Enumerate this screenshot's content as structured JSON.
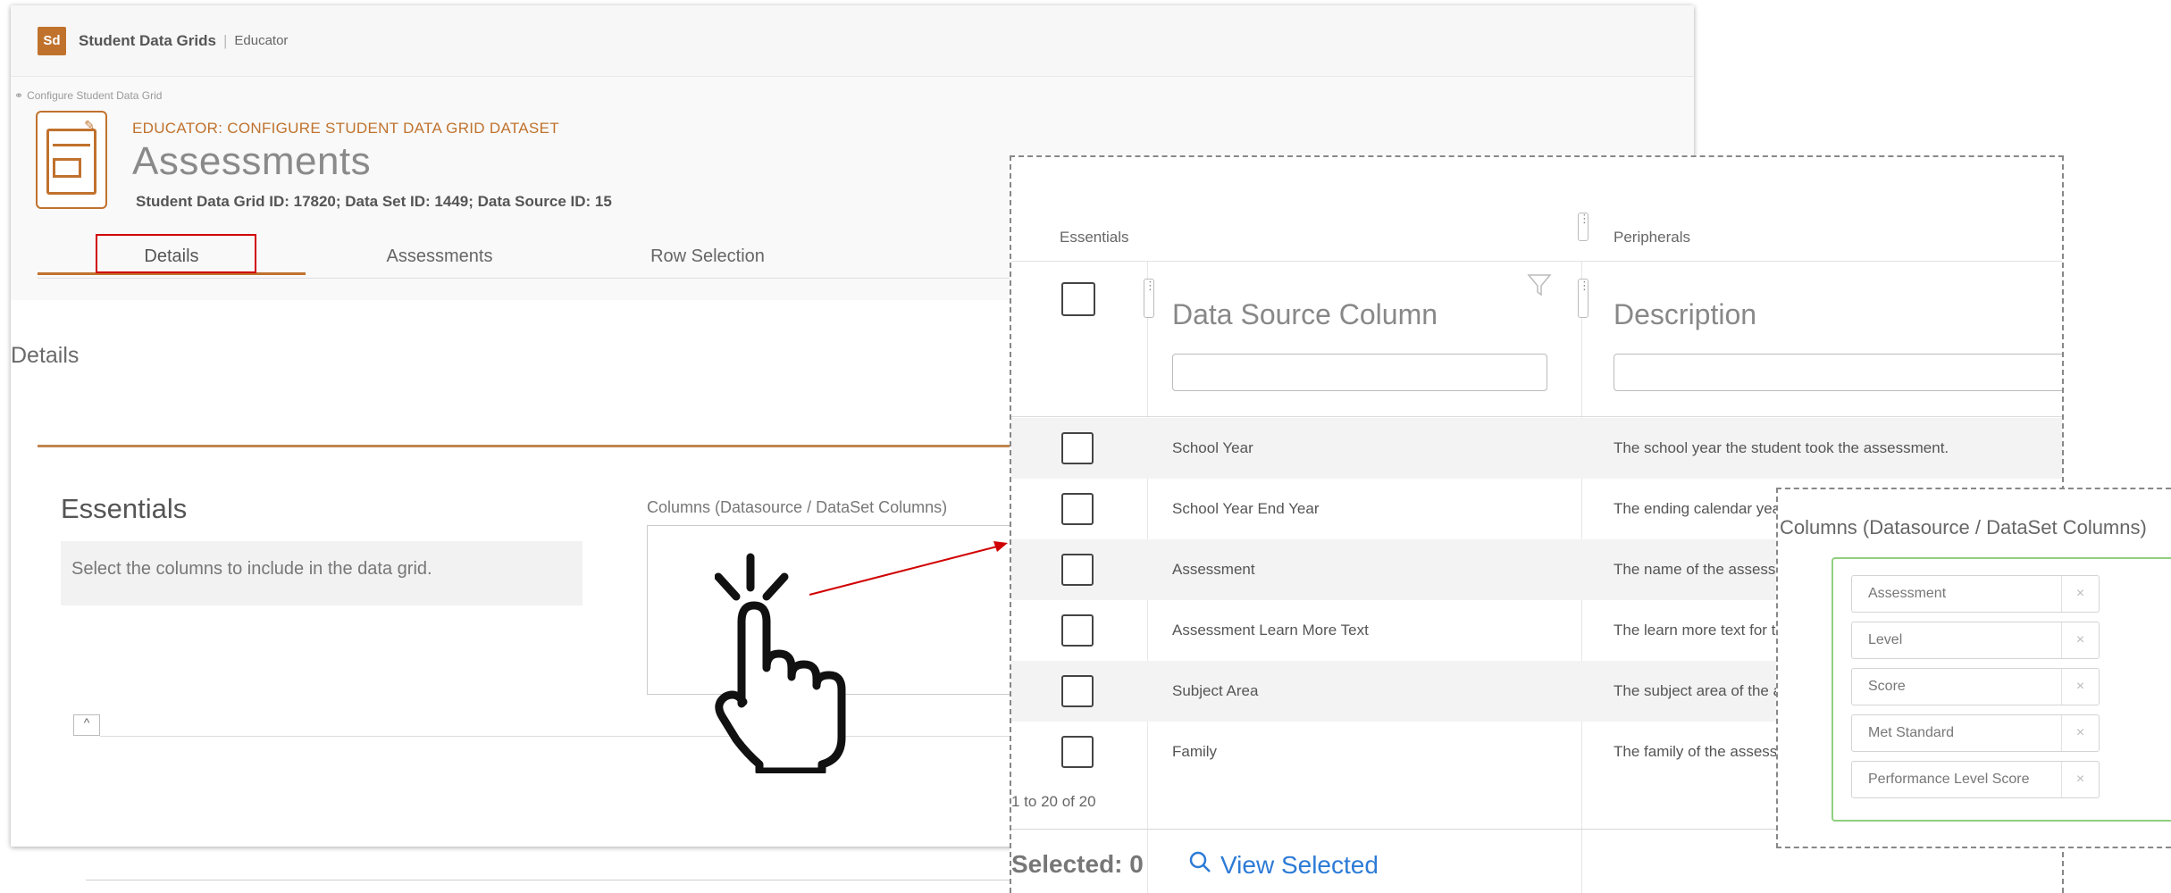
{
  "app": {
    "logo": "Sd",
    "title": "Student Data Grids",
    "separator": "|",
    "role": "Educator"
  },
  "breadcrumb": "Configure Student Data Grid",
  "header": {
    "eyebrow": "EDUCATOR: CONFIGURE STUDENT DATA GRID DATASET",
    "title": "Assessments",
    "ids": "Student Data Grid ID: 17820; Data Set ID: 1449; Data Source ID: 15"
  },
  "tabs": [
    {
      "label": "Details"
    },
    {
      "label": "Assessments"
    },
    {
      "label": "Row Selection"
    }
  ],
  "section": {
    "title": "Details"
  },
  "essentials": {
    "title": "Essentials",
    "description": "Select the columns to include in the data grid.",
    "columns_label": "Columns (Datasource / DataSet Columns)",
    "collapse_glyph": "^"
  },
  "grid": {
    "group_essentials": "Essentials",
    "group_peripherals": "Peripherals",
    "col_source": "Data Source Column",
    "col_description": "Description",
    "rows": [
      {
        "source": "School Year",
        "description": "The school year the student took the assessment."
      },
      {
        "source": "School Year End Year",
        "description": "The ending calendar year of the school year."
      },
      {
        "source": "Assessment",
        "description": "The name of the assessment."
      },
      {
        "source": "Assessment Learn More Text",
        "description": "The learn more text for the assessment."
      },
      {
        "source": "Subject Area",
        "description": "The subject area of the assessment."
      },
      {
        "source": "Family",
        "description": "The family of the assessment."
      }
    ],
    "paging": "1 to 20 of 20",
    "selected": "Selected: 0",
    "view_selected": "View Selected"
  },
  "selected_columns": {
    "title": "Columns (Datasource / DataSet Columns)",
    "items": [
      "Assessment",
      "Level",
      "Score",
      "Met Standard",
      "Performance Level Score"
    ],
    "remove_glyph": "×"
  },
  "colors": {
    "accent": "#c0722d",
    "highlight": "#d10000",
    "link": "#2c7bd6",
    "chip_border": "#8fcf7e"
  }
}
